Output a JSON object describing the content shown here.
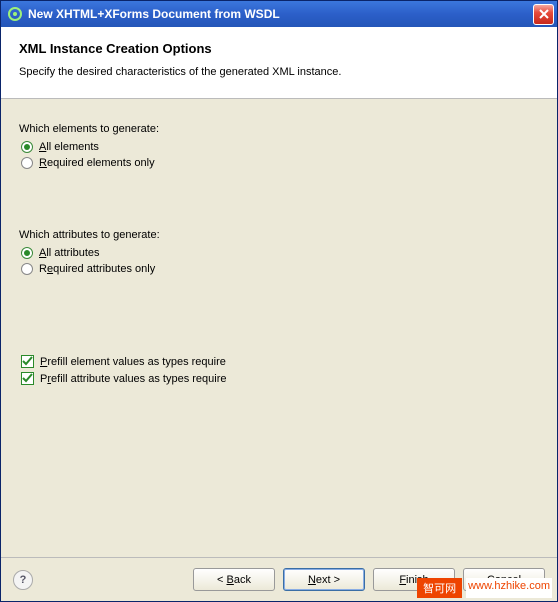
{
  "titlebar": {
    "title": "New XHTML+XForms Document from WSDL"
  },
  "header": {
    "title": "XML Instance Creation Options",
    "description": "Specify the desired characteristics of the generated XML instance."
  },
  "groups": {
    "elements": {
      "label": "Which elements to generate:",
      "options": {
        "all": "All elements",
        "required": "Required elements only"
      },
      "selected": "all"
    },
    "attributes": {
      "label": "Which attributes to generate:",
      "options": {
        "all": "All attributes",
        "required": "Required attributes only"
      },
      "selected": "all"
    }
  },
  "checkboxes": {
    "prefill_elements": {
      "label": "Prefill element values as types require",
      "checked": true
    },
    "prefill_attributes": {
      "label": "Prefill attribute values as types require",
      "checked": true
    }
  },
  "buttons": {
    "back": "< Back",
    "next": "Next >",
    "finish": "Finish",
    "cancel": "Cancel"
  },
  "help_tooltip": "?",
  "watermark": {
    "left": "智可网",
    "right": "www.hzhike.com"
  }
}
